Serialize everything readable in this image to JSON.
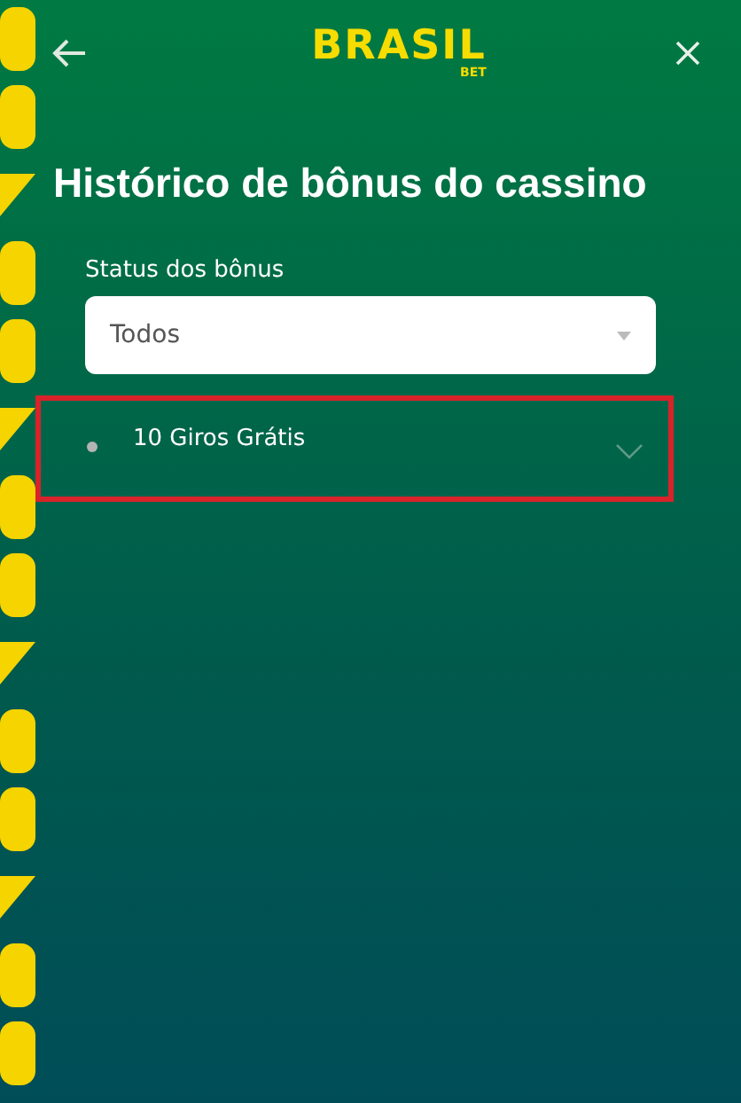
{
  "header": {
    "logo": {
      "name": "BRASIL",
      "sub": "BET"
    }
  },
  "title": "Histórico de bônus do cassino",
  "filter": {
    "label": "Status dos bônus",
    "value": "Todos"
  },
  "bonuses": [
    {
      "name": "10 Giros Grátis",
      "color": "#b4b4b4",
      "expanded": false,
      "highlighted": true
    }
  ]
}
